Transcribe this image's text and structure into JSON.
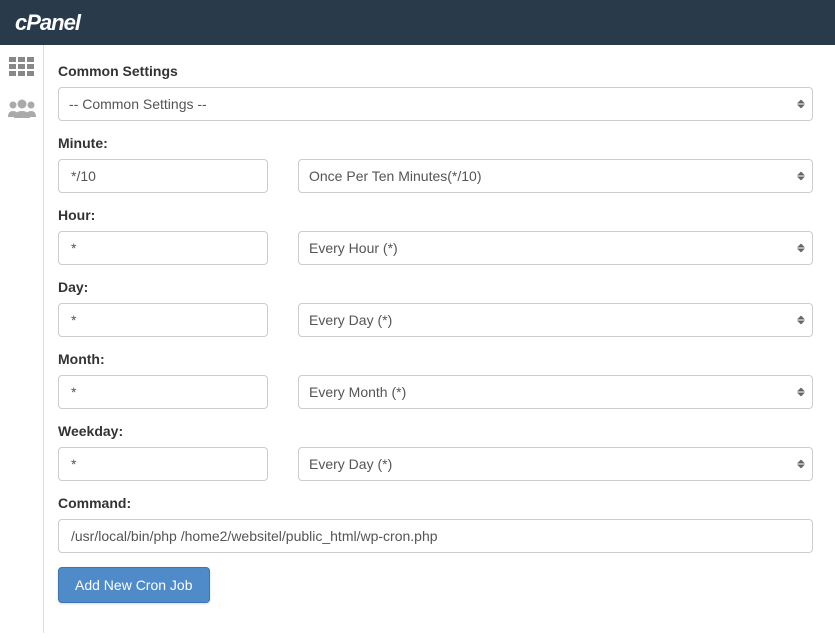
{
  "header": {
    "brand": "cPanel"
  },
  "form": {
    "common_settings": {
      "label": "Common Settings",
      "selected": "-- Common Settings --"
    },
    "minute": {
      "label": "Minute:",
      "value": "*/10",
      "selected": "Once Per Ten Minutes(*/10)"
    },
    "hour": {
      "label": "Hour:",
      "value": "*",
      "selected": "Every Hour (*)"
    },
    "day": {
      "label": "Day:",
      "value": "*",
      "selected": "Every Day (*)"
    },
    "month": {
      "label": "Month:",
      "value": "*",
      "selected": "Every Month (*)"
    },
    "weekday": {
      "label": "Weekday:",
      "value": "*",
      "selected": "Every Day (*)"
    },
    "command": {
      "label": "Command:",
      "value": "/usr/local/bin/php /home2/websitel/public_html/wp-cron.php"
    },
    "submit_label": "Add New Cron Job"
  }
}
